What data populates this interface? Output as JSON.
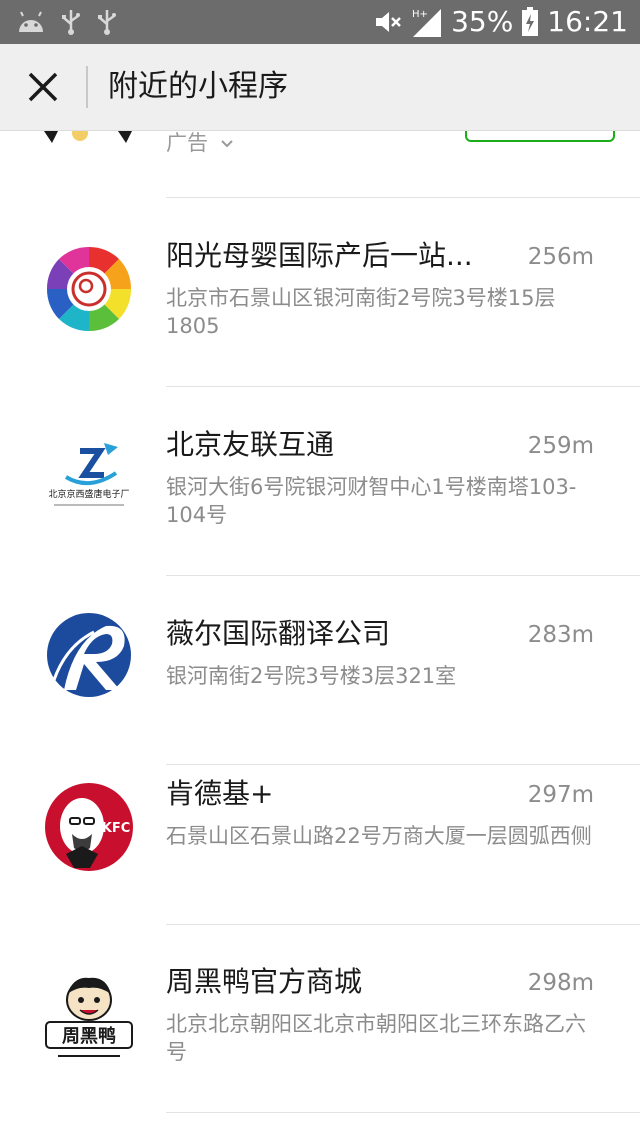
{
  "status_bar": {
    "battery": "35%",
    "time": "16:21",
    "network": "H+",
    "icons": [
      "android-icon",
      "usb-icon",
      "usb-icon",
      "mute-icon",
      "signal-icon",
      "battery-charging-icon"
    ]
  },
  "header": {
    "title": "附近的小程序",
    "close_icon": "close-icon"
  },
  "ad": {
    "label": "广告",
    "chevron_icon": "chevron-down-icon"
  },
  "items": [
    {
      "name": "阳光母婴国际产后一站...",
      "distance": "256m",
      "address": "北京市石景山区银河南街2号院3号楼15层1805",
      "logo": "rainbow-mother-baby-logo"
    },
    {
      "name": "北京友联互通",
      "distance": "259m",
      "address": "银河大街6号院银河财智中心1号楼南塔103-104号",
      "logo": "beijing-jingxi-shengtang-logo",
      "logo_text": "北京京西盛唐电子厂"
    },
    {
      "name": "薇尔国际翻译公司",
      "distance": "283m",
      "address": "银河南街2号院3号楼3层321室",
      "logo": "blue-r-logo"
    },
    {
      "name": "肯德基+",
      "distance": "297m",
      "address": "石景山区石景山路22号万商大厦一层圆弧西侧",
      "logo": "kfc-logo",
      "logo_text": "KFC"
    },
    {
      "name": "周黑鸭官方商城",
      "distance": "298m",
      "address": "北京北京朝阳区北京市朝阳区北三环东路乙六号",
      "logo": "zhou-hei-ya-logo",
      "logo_text": "周黑鸭"
    }
  ],
  "colors": {
    "status_bar_bg": "#6c6c6c",
    "title_bar_bg": "#efefef",
    "accent_green": "#1aad19",
    "secondary_text": "#8c8c8c"
  }
}
